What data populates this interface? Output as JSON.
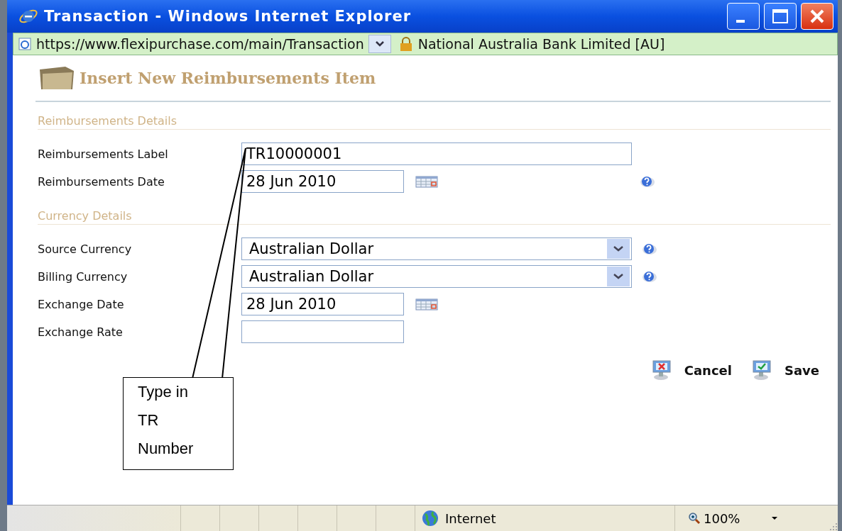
{
  "window": {
    "title": "Transaction - Windows Internet Explorer"
  },
  "address_bar": {
    "url": "https://www.flexipurchase.com/main/Transaction",
    "security": "National Australia Bank Limited [AU]"
  },
  "page": {
    "heading": "Insert New Reimbursements Item"
  },
  "sections": [
    {
      "title": "Reimbursements Details",
      "fields": [
        {
          "kind": "text",
          "label": "Reimbursements Label",
          "value": "TR10000001",
          "help": false
        },
        {
          "kind": "date",
          "label": "Reimbursements Date",
          "value": "28 Jun 2010",
          "help": true
        }
      ]
    },
    {
      "title": "Currency Details",
      "fields": [
        {
          "kind": "select",
          "label": "Source Currency",
          "value": "Australian Dollar",
          "help": true
        },
        {
          "kind": "select",
          "label": "Billing Currency",
          "value": "Australian Dollar",
          "help": true
        },
        {
          "kind": "date",
          "label": "Exchange Date",
          "value": "28 Jun 2010",
          "help": false
        },
        {
          "kind": "text",
          "label": "Exchange Rate",
          "help": false
        }
      ]
    }
  ],
  "buttons": [
    {
      "kind": "cancel",
      "label": "Cancel"
    },
    {
      "kind": "save",
      "label": "Save"
    }
  ],
  "callout": {
    "text": "Type in TR Number"
  },
  "status_bar": {
    "zone": "Internet",
    "zoom": "100%"
  }
}
